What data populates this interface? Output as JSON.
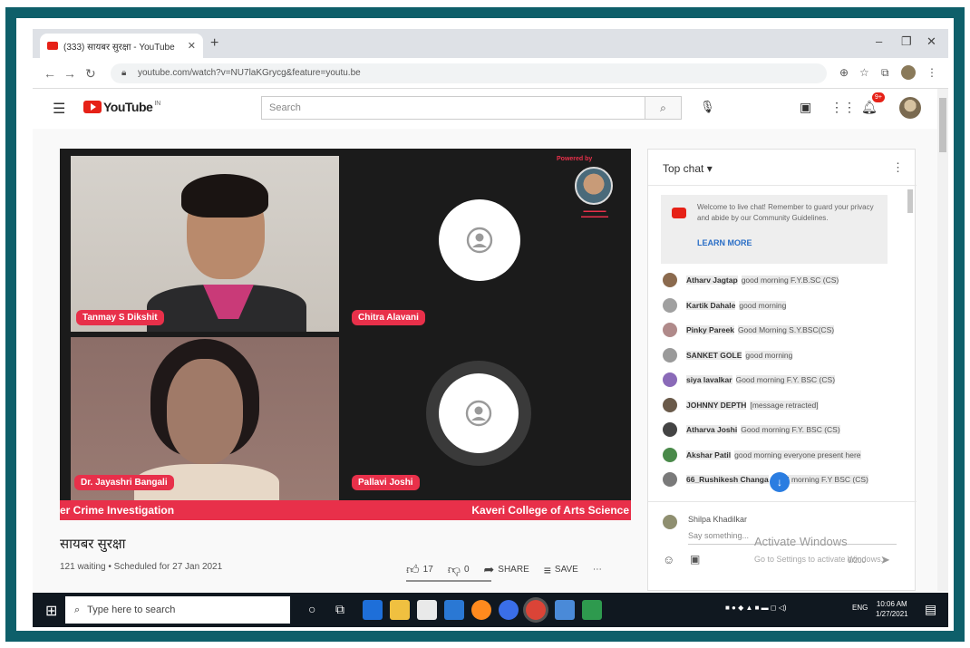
{
  "browser": {
    "tab_title": "(333) सायबर सुरक्षा - YouTube",
    "tab_close": "✕",
    "new_tab": "+",
    "url": "youtube.com/watch?v=NU7laKGrycg&feature=youtu.be"
  },
  "youtube": {
    "logo_text": "YouTube",
    "logo_region": "IN",
    "search_placeholder": "Search",
    "notification_count": "9+"
  },
  "video": {
    "participants": [
      {
        "name": "Tanmay S Dikshit",
        "camera": true
      },
      {
        "name": "Chitra Alavani",
        "camera": false
      },
      {
        "name": "Dr. Jayashri Bangali",
        "camera": true
      },
      {
        "name": "Pallavi Joshi",
        "camera": false
      }
    ],
    "powered_by": "Powered by",
    "ticker_left": "er Crime Investigation",
    "ticker_right": "Kaveri College of Arts Science"
  },
  "info": {
    "title": "सायबर सुरक्षा",
    "meta": "121 waiting • Scheduled for 27 Jan 2021",
    "likes": "17",
    "dislikes": "0",
    "share_label": "SHARE",
    "save_label": "SAVE",
    "more_label": "⋯"
  },
  "chat": {
    "header": "Top chat ▾",
    "welcome": "Welcome to live chat! Remember to guard your privacy and abide by our Community Guidelines.",
    "learn_more": "LEARN MORE",
    "messages": [
      {
        "name": "Atharv Jagtap",
        "text": "good morning F.Y.B.SC (CS)",
        "color": "#8b6a4e"
      },
      {
        "name": "Kartik Dahale",
        "text": "good morning",
        "color": "#a0a0a0"
      },
      {
        "name": "Pinky Pareek",
        "text": "Good Morning S.Y.BSC(CS)",
        "color": "#b08a8a"
      },
      {
        "name": "SANKET GOLE",
        "text": "good morning",
        "color": "#9a9a9a"
      },
      {
        "name": "siya lavalkar",
        "text": "Good morning F.Y. BSC (CS)",
        "color": "#8a6ab8"
      },
      {
        "name": "JOHNNY DEPTH",
        "text": "[message retracted]",
        "color": "#6a5a4a"
      },
      {
        "name": "Atharva Joshi",
        "text": "Good morning F.Y. BSC (CS)",
        "color": "#444444"
      },
      {
        "name": "Akshar Patil",
        "text": "good morning everyone present here",
        "color": "#4a8a4a"
      },
      {
        "name": "66_Rushikesh Changa",
        "text": "good morning F.Y BSC (CS)",
        "color": "#7a7a7a"
      }
    ],
    "current_user": "Shilpa Khadilkar",
    "say_placeholder": "Say something...",
    "char_count": "0/200"
  },
  "overlay": {
    "activate_title": "Activate Windows",
    "activate_sub": "Go to Settings to activate Windows."
  },
  "taskbar": {
    "search_text": "Type here to search",
    "lang": "ENG",
    "time": "10:06 AM",
    "date": "1/27/2021"
  }
}
